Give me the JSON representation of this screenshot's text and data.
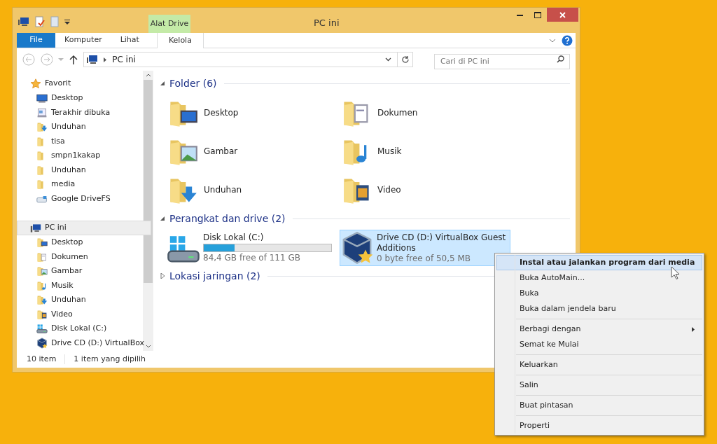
{
  "window": {
    "title": "PC ini",
    "context_tab": "Alat Drive"
  },
  "ribbon_tabs": [
    {
      "label": "File",
      "kind": "file"
    },
    {
      "label": "Komputer",
      "kind": "tab"
    },
    {
      "label": "Lihat",
      "kind": "tab"
    },
    {
      "label": "Kelola",
      "kind": "context"
    }
  ],
  "address": {
    "path": "PC ini",
    "search_placeholder": "Cari di PC ini"
  },
  "sidebar": [
    {
      "label": "Favorit",
      "kind": "star",
      "selected": false,
      "children": [
        {
          "label": "Desktop",
          "kind": "desktop"
        },
        {
          "label": "Terakhir dibuka",
          "kind": "recent"
        },
        {
          "label": "Unduhan",
          "kind": "download"
        },
        {
          "label": "tisa",
          "kind": "folder"
        },
        {
          "label": "smpn1kakap",
          "kind": "folder"
        },
        {
          "label": "Unduhan",
          "kind": "folder"
        },
        {
          "label": "media",
          "kind": "folder"
        },
        {
          "label": "Google DriveFS",
          "kind": "netdrive"
        }
      ]
    },
    {
      "label": "PC ini",
      "kind": "pc",
      "selected": true,
      "children": [
        {
          "label": "Desktop",
          "kind": "desktop-folder"
        },
        {
          "label": "Dokumen",
          "kind": "documents"
        },
        {
          "label": "Gambar",
          "kind": "pictures"
        },
        {
          "label": "Musik",
          "kind": "music"
        },
        {
          "label": "Unduhan",
          "kind": "download"
        },
        {
          "label": "Video",
          "kind": "video"
        },
        {
          "label": "Disk Lokal (C:)",
          "kind": "disk"
        },
        {
          "label": "Drive CD (D:)  VirtualBox",
          "kind": "cd"
        }
      ]
    }
  ],
  "sections": [
    {
      "title": "Folder (6)",
      "expanded": true,
      "folders": [
        {
          "label": "Desktop",
          "kind": "desktop-folder"
        },
        {
          "label": "Dokumen",
          "kind": "documents"
        },
        {
          "label": "Gambar",
          "kind": "pictures"
        },
        {
          "label": "Musik",
          "kind": "music"
        },
        {
          "label": "Unduhan",
          "kind": "download"
        },
        {
          "label": "Video",
          "kind": "video"
        }
      ]
    },
    {
      "title": "Perangkat dan drive (2)",
      "expanded": true,
      "drives": [
        {
          "name": "Disk Lokal (C:)",
          "kind": "disk",
          "level": 0.24,
          "free": "84,4 GB free of 111 GB",
          "selected": false
        },
        {
          "name": "Drive CD (D:)  VirtualBox Guest Additions",
          "kind": "cd",
          "free": "0 byte free of 50,5 MB",
          "selected": true
        }
      ]
    },
    {
      "title": "Lokasi jaringan (2)",
      "expanded": false
    }
  ],
  "status_bar": {
    "count": "10 item",
    "selection": "1 item yang dipilih"
  },
  "context_menu": [
    [
      {
        "label": "Instal atau jalankan program dari media",
        "bold": true,
        "selected": true
      },
      {
        "label": "Buka AutoMain...",
        "bold": false,
        "selected": false
      },
      {
        "label": "Buka",
        "bold": false,
        "selected": false
      },
      {
        "label": "Buka dalam jendela baru",
        "bold": false,
        "selected": false
      }
    ],
    [
      {
        "label": "Berbagi dengan",
        "bold": false,
        "selected": false,
        "submenu": true
      },
      {
        "label": "Semat ke Mulai",
        "bold": false,
        "selected": false
      }
    ],
    [
      {
        "label": "Keluarkan",
        "bold": false,
        "selected": false
      }
    ],
    [
      {
        "label": "Salin",
        "bold": false,
        "selected": false
      }
    ],
    [
      {
        "label": "Buat pintasan",
        "bold": false,
        "selected": false
      }
    ],
    [
      {
        "label": "Properti",
        "bold": false,
        "selected": false
      }
    ]
  ]
}
